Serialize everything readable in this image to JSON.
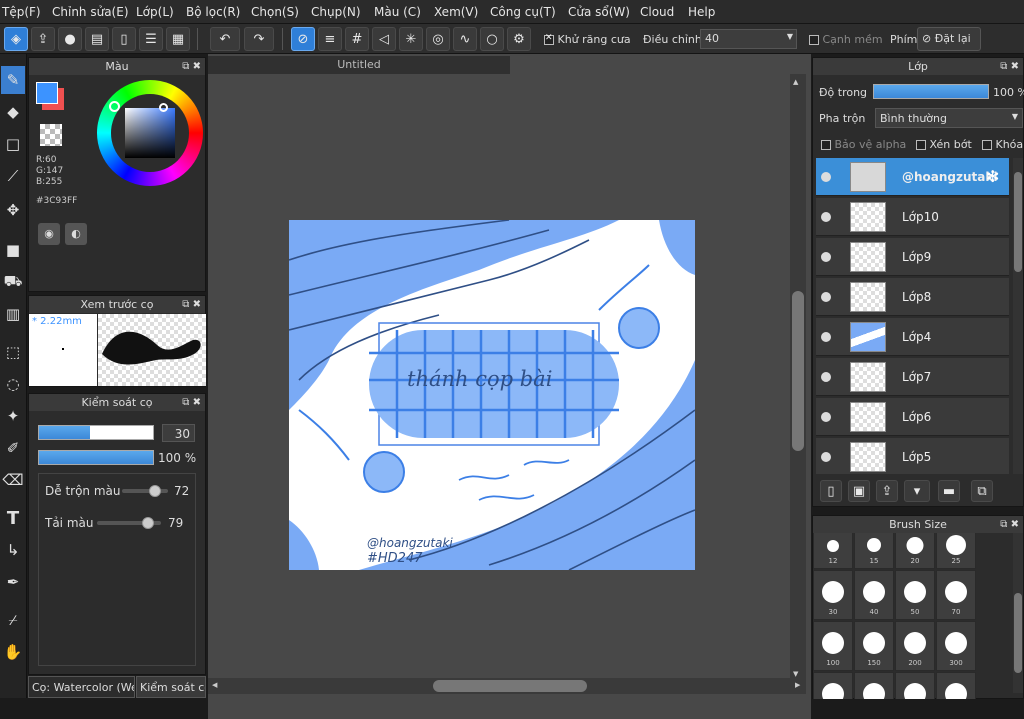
{
  "menu": [
    "Tệp(F)",
    "Chỉnh sửa(E)",
    "Lớp(L)",
    "Bộ lọc(R)",
    "Chọn(S)",
    "Chụp(N)",
    "Màu (C)",
    "Xem(V)",
    "Công cụ(T)",
    "Cửa sổ(W)",
    "Cloud",
    "Help"
  ],
  "toolbar": {
    "antialias_label": "Khử răng cưa",
    "adjust_label": "Điều chỉnh",
    "adjust_value": "40",
    "smooth_label": "Cạnh mềm",
    "key_label": "Phím",
    "reset_label": "Đặt lại"
  },
  "color_panel": {
    "title": "Màu",
    "r": "R:60",
    "g": "G:147",
    "b": "B:255",
    "hex": "#3C93FF",
    "fg": "#3C93FF",
    "bg": "#F05050"
  },
  "brush_preview": {
    "title": "Xem trước cọ",
    "size": "* 2.22mm"
  },
  "brush_control": {
    "title": "Kiểm soát cọ",
    "size_value": "30",
    "size_fraction": 0.45,
    "opacity_value": "100 %",
    "opacity_fraction": 1.0,
    "blend_label": "Dễ trộn màu",
    "blend_value": "72",
    "blend_fraction": 0.72,
    "reload_label": "Tải màu",
    "reload_value": "79",
    "reload_fraction": 0.79
  },
  "bottom_tabs": {
    "tab1": "Cọ: Watercolor (Wet",
    "tab2": "Kiểm soát cọ"
  },
  "document": {
    "title": "Untitled",
    "art_text": "thánh cọp bài",
    "signature": "@hoangzutaki",
    "tag": "#HD247"
  },
  "layers_panel": {
    "title": "Lớp",
    "opacity_label": "Độ trong",
    "opacity_value": "100 %",
    "opacity_fraction": 1.0,
    "blend_label": "Pha trộn",
    "blend_value": "Bình thường",
    "protect_alpha": "Bảo vệ alpha",
    "clip": "Xén bớt",
    "lock": "Khóa",
    "layers": [
      {
        "name": "@hoangzutaki"
      },
      {
        "name": "Lớp10"
      },
      {
        "name": "Lớp9"
      },
      {
        "name": "Lớp8"
      },
      {
        "name": "Lớp4"
      },
      {
        "name": "Lớp7"
      },
      {
        "name": "Lớp6"
      },
      {
        "name": "Lớp5"
      }
    ]
  },
  "brush_size": {
    "title": "Brush Size",
    "sizes": [
      "12",
      "15",
      "20",
      "25",
      "30",
      "40",
      "50",
      "70",
      "100",
      "150",
      "200",
      "300",
      "",
      "",
      "",
      ""
    ]
  }
}
